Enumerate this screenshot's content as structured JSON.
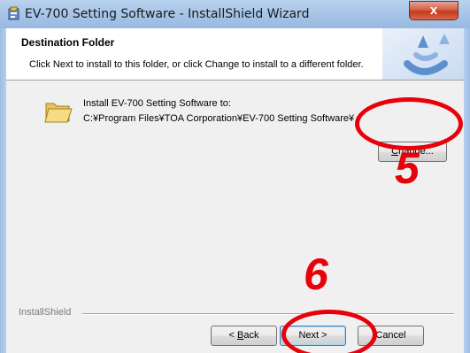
{
  "window": {
    "title": "EV-700 Setting Software - InstallShield Wizard",
    "close_label": "x"
  },
  "header": {
    "title": "Destination Folder",
    "description": "Click Next to install to this folder, or click Change to install to a different folder."
  },
  "main": {
    "install_to_label": "Install EV-700 Setting Software to:",
    "install_path": "C:¥Program Files¥TOA Corporation¥EV-700 Setting Software¥",
    "change_button": {
      "prefix": "",
      "mnemonic": "C",
      "rest": "hange..."
    }
  },
  "footer": {
    "brand": "InstallShield",
    "back_button": {
      "prefix": "< ",
      "mnemonic": "B",
      "rest": "ack"
    },
    "next_button": "Next >",
    "cancel_button": "Cancel"
  },
  "annotations": {
    "step_change": "5",
    "step_next": "6",
    "color": "#e8000b"
  },
  "icons": {
    "app": "installer-icon",
    "folder": "folder-icon",
    "header_graphic": "installshield-logo"
  }
}
